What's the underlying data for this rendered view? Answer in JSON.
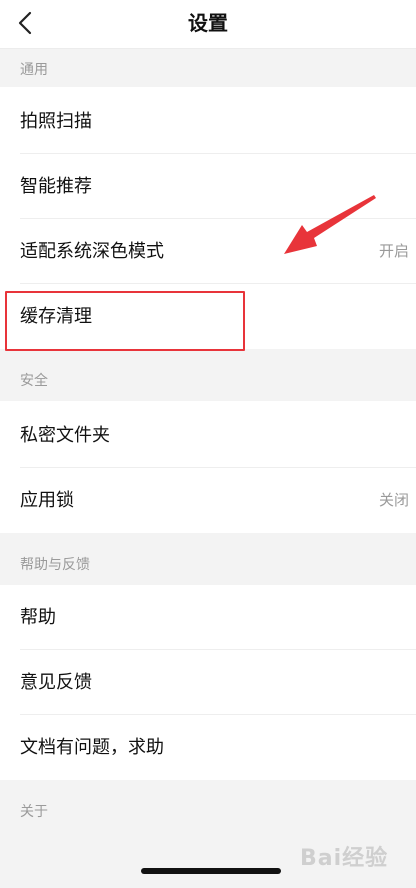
{
  "header": {
    "title": "设置",
    "back_icon": "chevron-left-icon"
  },
  "sections": [
    {
      "title": "通用",
      "items": [
        {
          "label": "拍照扫描",
          "value": ""
        },
        {
          "label": "智能推荐",
          "value": ""
        },
        {
          "label": "适配系统深色模式",
          "value": "开启"
        },
        {
          "label": "缓存清理",
          "value": ""
        }
      ]
    },
    {
      "title": "安全",
      "items": [
        {
          "label": "私密文件夹",
          "value": ""
        },
        {
          "label": "应用锁",
          "value": "关闭"
        }
      ]
    },
    {
      "title": "帮助与反馈",
      "items": [
        {
          "label": "帮助",
          "value": ""
        },
        {
          "label": "意见反馈",
          "value": ""
        },
        {
          "label": "文档有问题，求助",
          "value": ""
        }
      ]
    },
    {
      "title": "关于",
      "items": []
    }
  ],
  "annotation": {
    "highlight_color": "#e8343a",
    "arrow_color": "#e8343a"
  },
  "watermark": {
    "text": "Bai经验"
  }
}
